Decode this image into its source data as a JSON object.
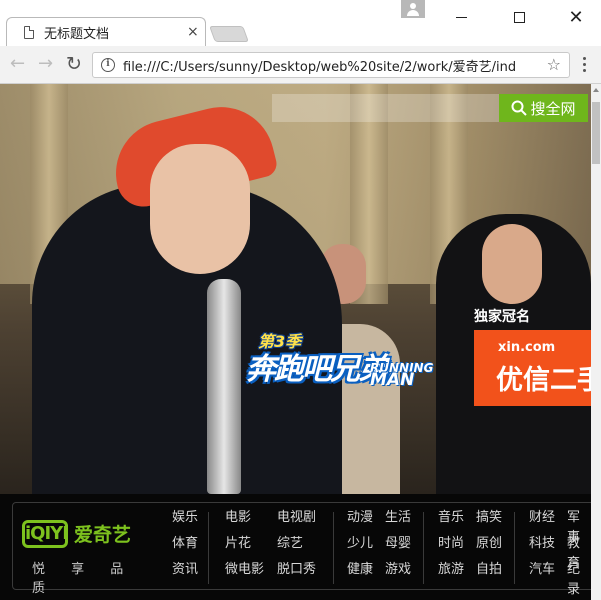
{
  "browser": {
    "tab_title": "无标题文档",
    "tab_close": "×",
    "url": "file:///C:/Users/sunny/Desktop/web%20site/2/work/爱奇艺/ind",
    "close_glyph": "✕"
  },
  "search": {
    "placeholder": "",
    "button_label": "搜全网"
  },
  "hero": {
    "show_logo": {
      "season": "第3季",
      "title": "奔跑吧兄弟",
      "subtitle_line1": "RUNNING",
      "subtitle_line2": "MAN"
    },
    "sponsor_label": "独家冠名",
    "sponsor_domain": "xin.com",
    "sponsor_name": "优信二手车"
  },
  "footer": {
    "brand_logo": "iQIYI",
    "brand_name": "爱奇艺",
    "slogan": "悦 享 品 质",
    "nav_columns": [
      [
        "娱乐",
        "体育",
        "资讯"
      ],
      [
        "电影",
        "片花",
        "微电影"
      ],
      [
        "电视剧",
        "综艺",
        "脱口秀"
      ],
      [
        "动漫",
        "少儿",
        "健康"
      ],
      [
        "生活",
        "母婴",
        "游戏"
      ],
      [
        "音乐",
        "时尚",
        "旅游"
      ],
      [
        "搞笑",
        "原创",
        "自拍"
      ],
      [
        "财经",
        "科技",
        "汽车"
      ],
      [
        "军事",
        "教育",
        "纪录片"
      ]
    ]
  },
  "colors": {
    "accent_green": "#6fb61c",
    "sponsor_orange": "#f2521b",
    "footer_bg": "#070707"
  }
}
